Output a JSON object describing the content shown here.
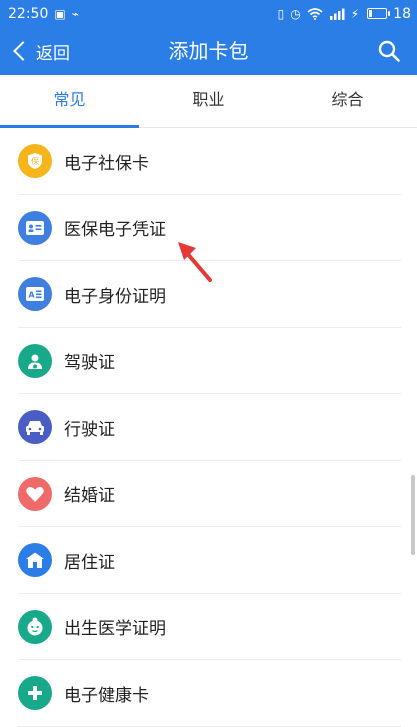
{
  "status_bar": {
    "time": "22:50",
    "battery_level": "18"
  },
  "header": {
    "back_label": "返回",
    "title": "添加卡包"
  },
  "tabs": [
    {
      "label": "常见",
      "active": true
    },
    {
      "label": "职业",
      "active": false
    },
    {
      "label": "综合",
      "active": false
    }
  ],
  "list": [
    {
      "label": "电子社保卡",
      "icon": "social-security-card-icon",
      "color": "#f5b51b"
    },
    {
      "label": "医保电子凭证",
      "icon": "medical-insurance-icon",
      "color": "#3f7fe0"
    },
    {
      "label": "电子身份证明",
      "icon": "id-card-icon",
      "color": "#3f7fe0"
    },
    {
      "label": "驾驶证",
      "icon": "driver-license-icon",
      "color": "#18a98a"
    },
    {
      "label": "行驶证",
      "icon": "vehicle-license-icon",
      "color": "#4a5dc4"
    },
    {
      "label": "结婚证",
      "icon": "marriage-certificate-icon",
      "color": "#f06a6a"
    },
    {
      "label": "居住证",
      "icon": "residence-permit-icon",
      "color": "#2a7ee6"
    },
    {
      "label": "出生医学证明",
      "icon": "birth-certificate-icon",
      "color": "#18a98a"
    },
    {
      "label": "电子健康卡",
      "icon": "health-card-icon",
      "color": "#18a98a"
    }
  ],
  "colors": {
    "brand": "#2a7ee6",
    "annotation_arrow": "#e53935"
  }
}
